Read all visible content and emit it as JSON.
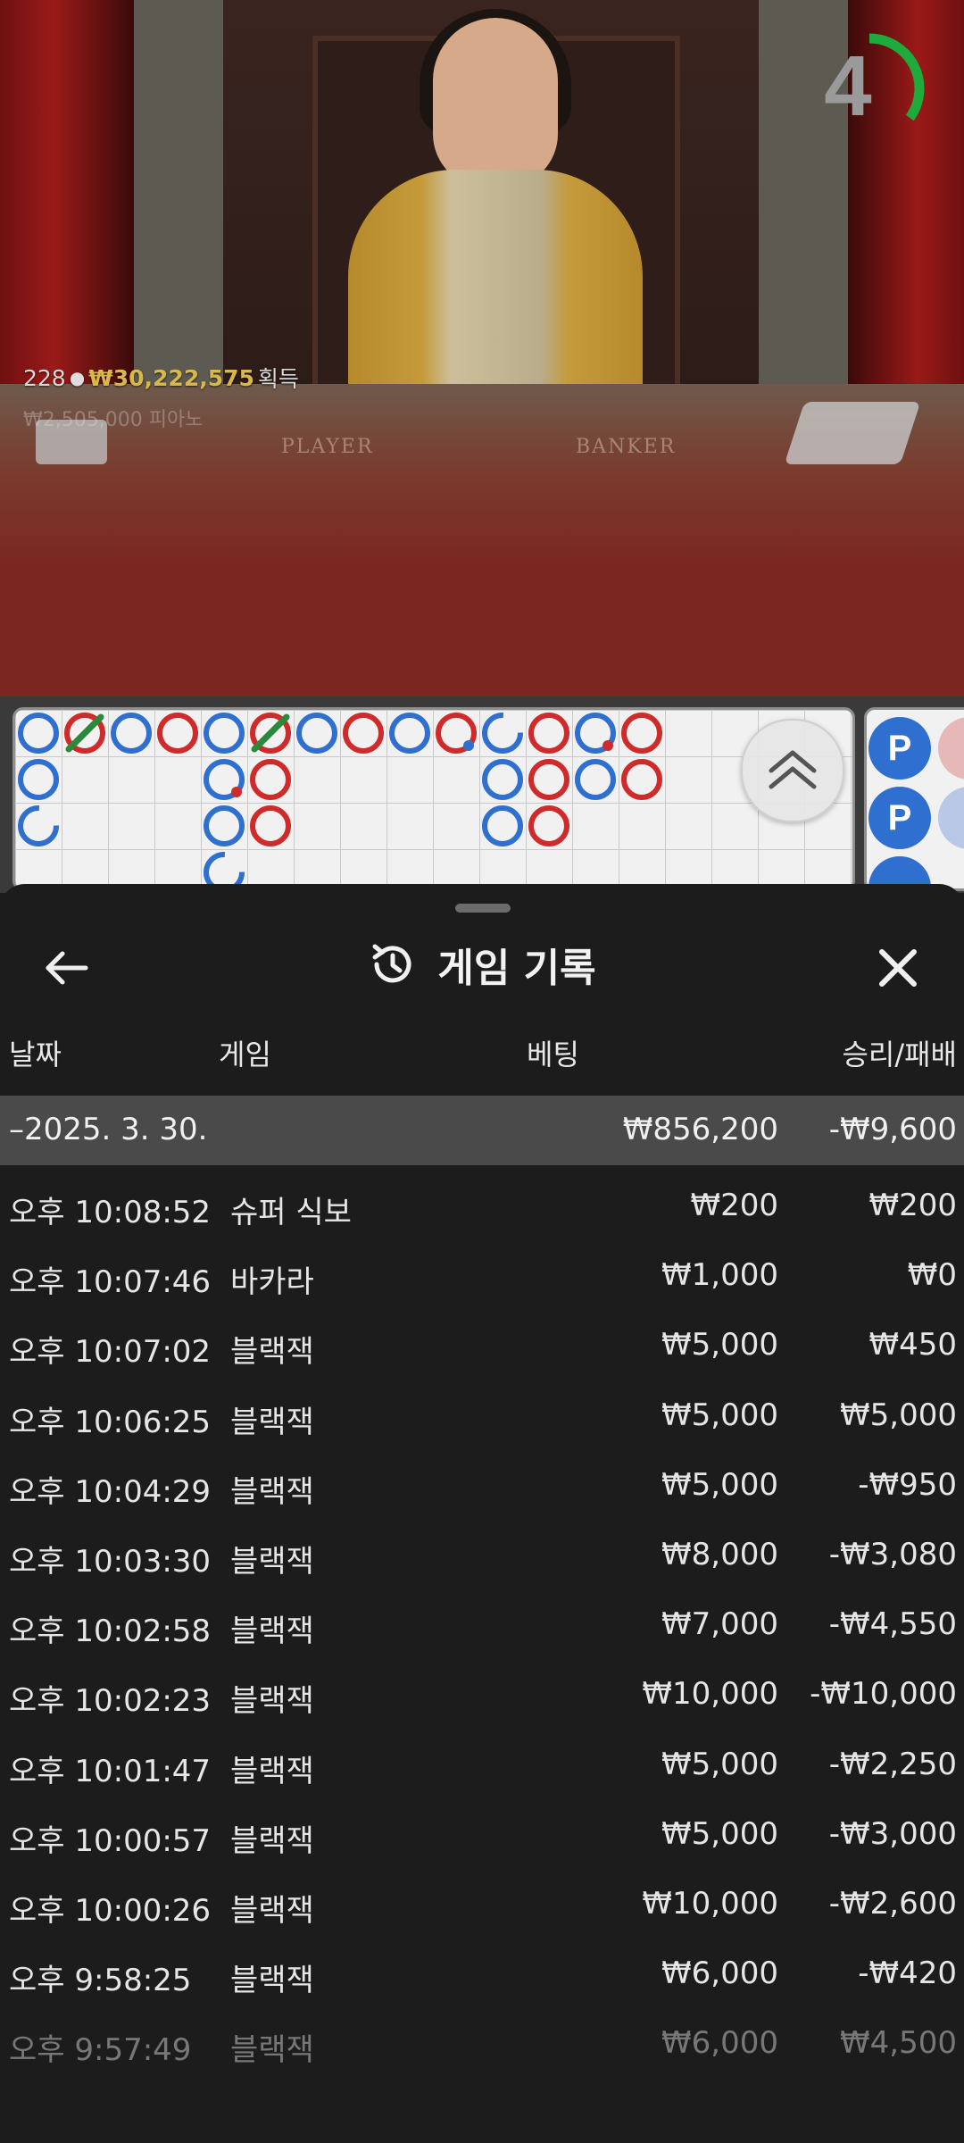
{
  "live_stream": {
    "player_count": "228",
    "winnings": "₩30,222,575",
    "winnings_suffix": "획득",
    "faded_text": "₩2,505,000 피아노",
    "table_label_player": "PLAYER",
    "table_label_banker": "BANKER",
    "countdown": "4",
    "countdown_fraction": 0.35,
    "colors": {
      "winnings": "#d8b84a",
      "timer_arc": "#1faa3c"
    }
  },
  "roadmap": {
    "side_badge_label": "P",
    "colors": {
      "player": "#2f6fd0",
      "banker": "#cf2b2b",
      "tie": "#2a8a3a"
    }
  },
  "history": {
    "title": "게임 기록",
    "columns": {
      "date": "날짜",
      "game": "게임",
      "bet": "베팅",
      "result": "승리/패배"
    },
    "date_group": {
      "label": "–2025. 3. 30.",
      "total_bet": "₩856,200",
      "total_result": "-₩9,600"
    },
    "rows": [
      {
        "time": "오후 10:08:52",
        "game": "슈퍼 식보",
        "bet": "₩200",
        "result": "₩200"
      },
      {
        "time": "오후 10:07:46",
        "game": "바카라",
        "bet": "₩1,000",
        "result": "₩0"
      },
      {
        "time": "오후 10:07:02",
        "game": "블랙잭",
        "bet": "₩5,000",
        "result": "₩450"
      },
      {
        "time": "오후 10:06:25",
        "game": "블랙잭",
        "bet": "₩5,000",
        "result": "₩5,000"
      },
      {
        "time": "오후 10:04:29",
        "game": "블랙잭",
        "bet": "₩5,000",
        "result": "-₩950"
      },
      {
        "time": "오후 10:03:30",
        "game": "블랙잭",
        "bet": "₩8,000",
        "result": "-₩3,080"
      },
      {
        "time": "오후 10:02:58",
        "game": "블랙잭",
        "bet": "₩7,000",
        "result": "-₩4,550"
      },
      {
        "time": "오후 10:02:23",
        "game": "블랙잭",
        "bet": "₩10,000",
        "result": "-₩10,000"
      },
      {
        "time": "오후 10:01:47",
        "game": "블랙잭",
        "bet": "₩5,000",
        "result": "-₩2,250"
      },
      {
        "time": "오후 10:00:57",
        "game": "블랙잭",
        "bet": "₩5,000",
        "result": "-₩3,000"
      },
      {
        "time": "오후 10:00:26",
        "game": "블랙잭",
        "bet": "₩10,000",
        "result": "-₩2,600"
      },
      {
        "time": "오후 9:58:25",
        "game": "블랙잭",
        "bet": "₩6,000",
        "result": "-₩420"
      },
      {
        "time": "오후 9:57:49",
        "game": "블랙잭",
        "bet": "₩6,000",
        "result": "₩4,500"
      }
    ]
  }
}
